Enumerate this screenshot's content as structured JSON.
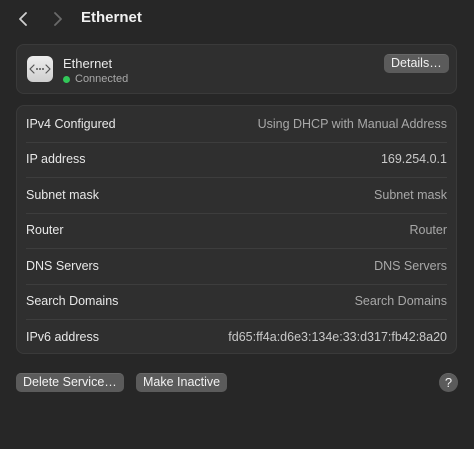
{
  "header": {
    "title": "Ethernet"
  },
  "interface": {
    "name": "Ethernet",
    "status": "Connected",
    "details_label": "Details…",
    "icon": "ethernet-icon",
    "status_color": "#32c759"
  },
  "rows": [
    {
      "label": "IPv4 Configured",
      "value": "Using DHCP with Manual Address"
    },
    {
      "label": "IP address",
      "value": "169.254.0.1"
    },
    {
      "label": "Subnet mask",
      "value": "Subnet mask"
    },
    {
      "label": "Router",
      "value": "Router"
    },
    {
      "label": "DNS Servers",
      "value": "DNS Servers"
    },
    {
      "label": "Search Domains",
      "value": "Search Domains"
    },
    {
      "label": "IPv6 address",
      "value": "fd65:ff4a:d6e3:134e:33:d317:fb42:8a20"
    }
  ],
  "footer": {
    "delete_label": "Delete Service…",
    "inactive_label": "Make Inactive",
    "help_label": "?"
  }
}
